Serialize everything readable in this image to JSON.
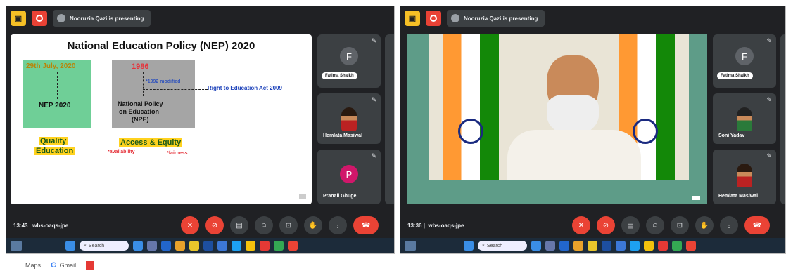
{
  "left": {
    "presenter": "Nooruzia Qazi is presenting",
    "slide": {
      "title": "National Education Policy (NEP) 2020",
      "date": "29th July, 2020",
      "nep": "NEP 2020",
      "year1986": "1986",
      "modified": "*1992 modified",
      "rte": "Right to Education Act 2009",
      "npe": [
        "National Policy",
        "on Education",
        "(NPE)"
      ],
      "quality": [
        "Quality",
        "Education"
      ],
      "access": "Access & Equity",
      "availability": "*availability",
      "fairness": "*fairness"
    },
    "tiles": [
      {
        "initial": "F",
        "name": "Fatima Shaikh"
      },
      {
        "name": "Hemlata Masiwal"
      },
      {
        "initial": "P",
        "name": "Pranali Ghuge"
      }
    ],
    "time": "13:43",
    "code": "wbs-oaqs-jpe",
    "search": "Search"
  },
  "right": {
    "presenter": "Nooruzia Qazi is presenting",
    "tiles": [
      {
        "initial": "F",
        "name": "Fatima Shaikh"
      },
      {
        "name": "Soni Yadav"
      },
      {
        "name": "Hemlata Masiwal"
      }
    ],
    "time": "13:36",
    "code": "wbs-oaqs-jpe",
    "search": "Search"
  },
  "bookmarks": [
    {
      "label": "Maps"
    },
    {
      "label": "Gmail"
    }
  ],
  "colors": {
    "meet_bg": "#202124",
    "red": "#ea4335",
    "tile": "#3c4043",
    "green_box": "#6fcf97"
  }
}
